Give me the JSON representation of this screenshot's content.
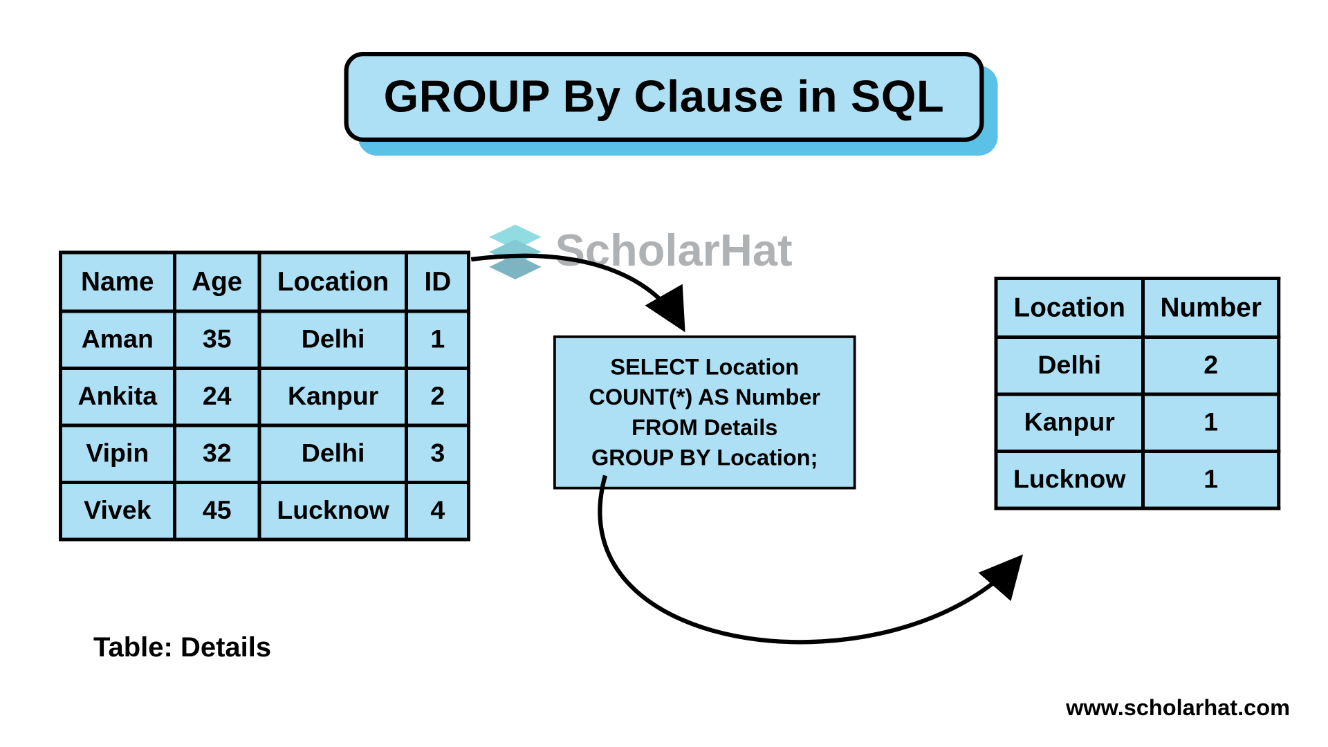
{
  "title": "GROUP By Clause in SQL",
  "watermark": "ScholarHat",
  "footer": "www.scholarhat.com",
  "caption": "Table: Details",
  "details_table": {
    "headers": [
      "Name",
      "Age",
      "Location",
      "ID"
    ],
    "rows": [
      [
        "Aman",
        "35",
        "Delhi",
        "1"
      ],
      [
        "Ankita",
        "24",
        "Kanpur",
        "2"
      ],
      [
        "Vipin",
        "32",
        "Delhi",
        "3"
      ],
      [
        "Vivek",
        "45",
        "Lucknow",
        "4"
      ]
    ]
  },
  "result_table": {
    "headers": [
      "Location",
      "Number"
    ],
    "rows": [
      [
        "Delhi",
        "2"
      ],
      [
        "Kanpur",
        "1"
      ],
      [
        "Lucknow",
        "1"
      ]
    ]
  },
  "sql": {
    "line1": "SELECT Location",
    "line2": "COUNT(*) AS Number",
    "line3": "FROM Details",
    "line4": "GROUP BY Location;"
  }
}
